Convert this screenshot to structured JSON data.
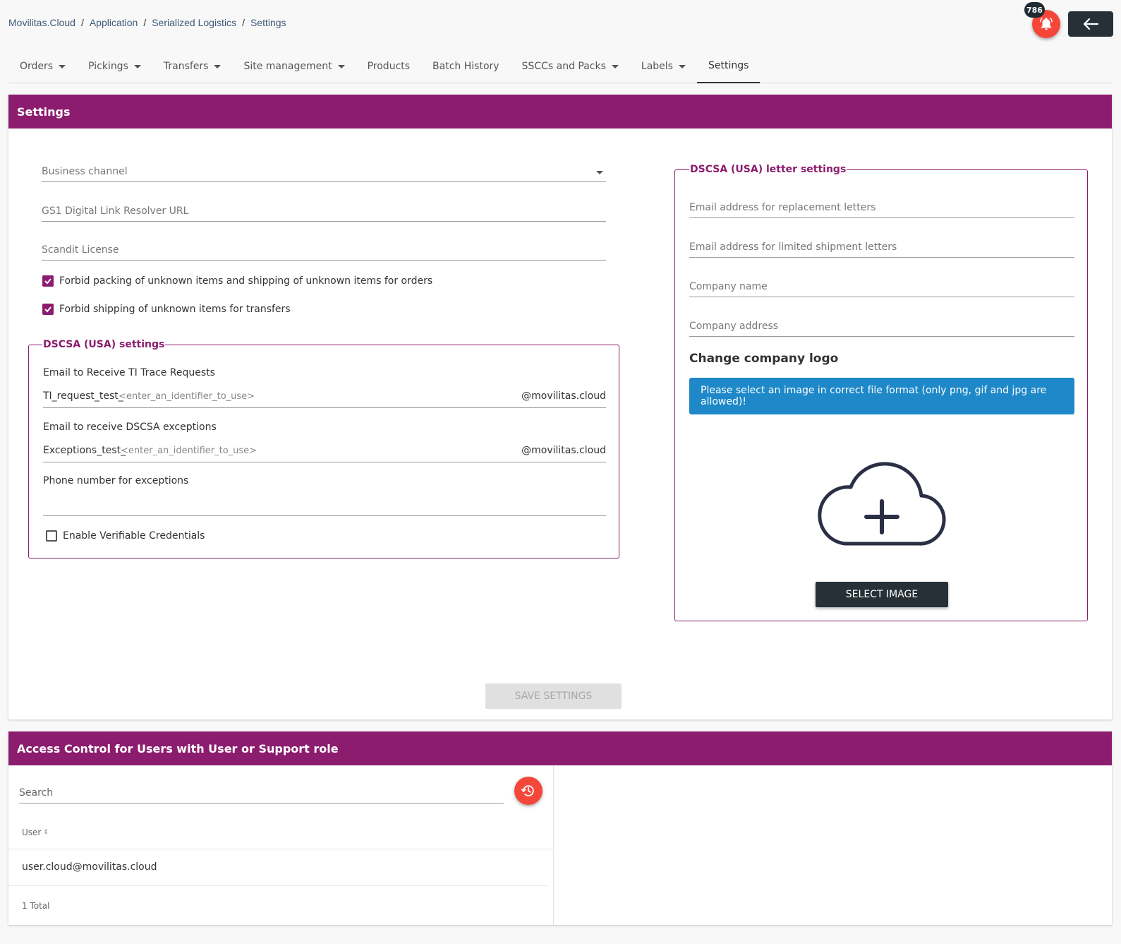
{
  "breadcrumb": {
    "items": [
      "Movilitas.Cloud",
      "Application",
      "Serialized Logistics",
      "Settings"
    ],
    "separator": "/"
  },
  "header": {
    "notification_count": "786",
    "notification_icon": "bell-icon",
    "back_icon": "arrow-left-icon"
  },
  "nav": {
    "tabs": [
      {
        "label": "Orders",
        "dropdown": true
      },
      {
        "label": "Pickings",
        "dropdown": true
      },
      {
        "label": "Transfers",
        "dropdown": true
      },
      {
        "label": "Site management",
        "dropdown": true
      },
      {
        "label": "Products",
        "dropdown": false
      },
      {
        "label": "Batch History",
        "dropdown": false
      },
      {
        "label": "SSCCs and Packs",
        "dropdown": true
      },
      {
        "label": "Labels",
        "dropdown": true
      },
      {
        "label": "Settings",
        "dropdown": false,
        "active": true
      }
    ]
  },
  "settings": {
    "title": "Settings",
    "business_channel_label": "Business channel",
    "gs1_label": "GS1 Digital Link Resolver URL",
    "scandit_label": "Scandit License",
    "forbid_packing_label": "Forbid packing of unknown items and shipping of unknown items for orders",
    "forbid_packing_checked": true,
    "forbid_shipping_label": "Forbid shipping of unknown items for transfers",
    "forbid_shipping_checked": true,
    "dscsa": {
      "legend": "DSCSA (USA) settings",
      "ti_label": "Email to Receive TI Trace Requests",
      "ti_prefix": "TI_request_test_",
      "ti_placeholder": "<enter_an_identifier_to_use>",
      "ti_suffix": "@movilitas.cloud",
      "exc_label": "Email to receive DSCSA exceptions",
      "exc_prefix": "Exceptions_test_",
      "exc_placeholder": "<enter_an_identifier_to_use>",
      "exc_suffix": "@movilitas.cloud",
      "phone_label": "Phone number for exceptions",
      "vc_label": "Enable Verifiable Credentials",
      "vc_checked": false
    },
    "letter": {
      "legend": "DSCSA (USA) letter settings",
      "replacement_label": "Email address for replacement letters",
      "limited_label": "Email address for limited shipment letters",
      "company_name_label": "Company name",
      "company_address_label": "Company address",
      "logo_heading": "Change company logo",
      "info_text": "Please select an image in correct file format (only png, gif and jpg are allowed)!",
      "upload_icon": "cloud-upload-icon",
      "select_image_label": "SELECT IMAGE"
    },
    "save_label": "SAVE SETTINGS"
  },
  "access": {
    "title": "Access Control for Users with User or Support role",
    "search_placeholder": "Search",
    "history_icon": "history-icon",
    "column_user": "User",
    "rows": [
      "user.cloud@movilitas.cloud"
    ],
    "total": "1 Total"
  },
  "colors": {
    "brand": "#8c1c6e",
    "accent_red": "#f4473a",
    "info_blue": "#1e88c8",
    "dark": "#263036"
  }
}
